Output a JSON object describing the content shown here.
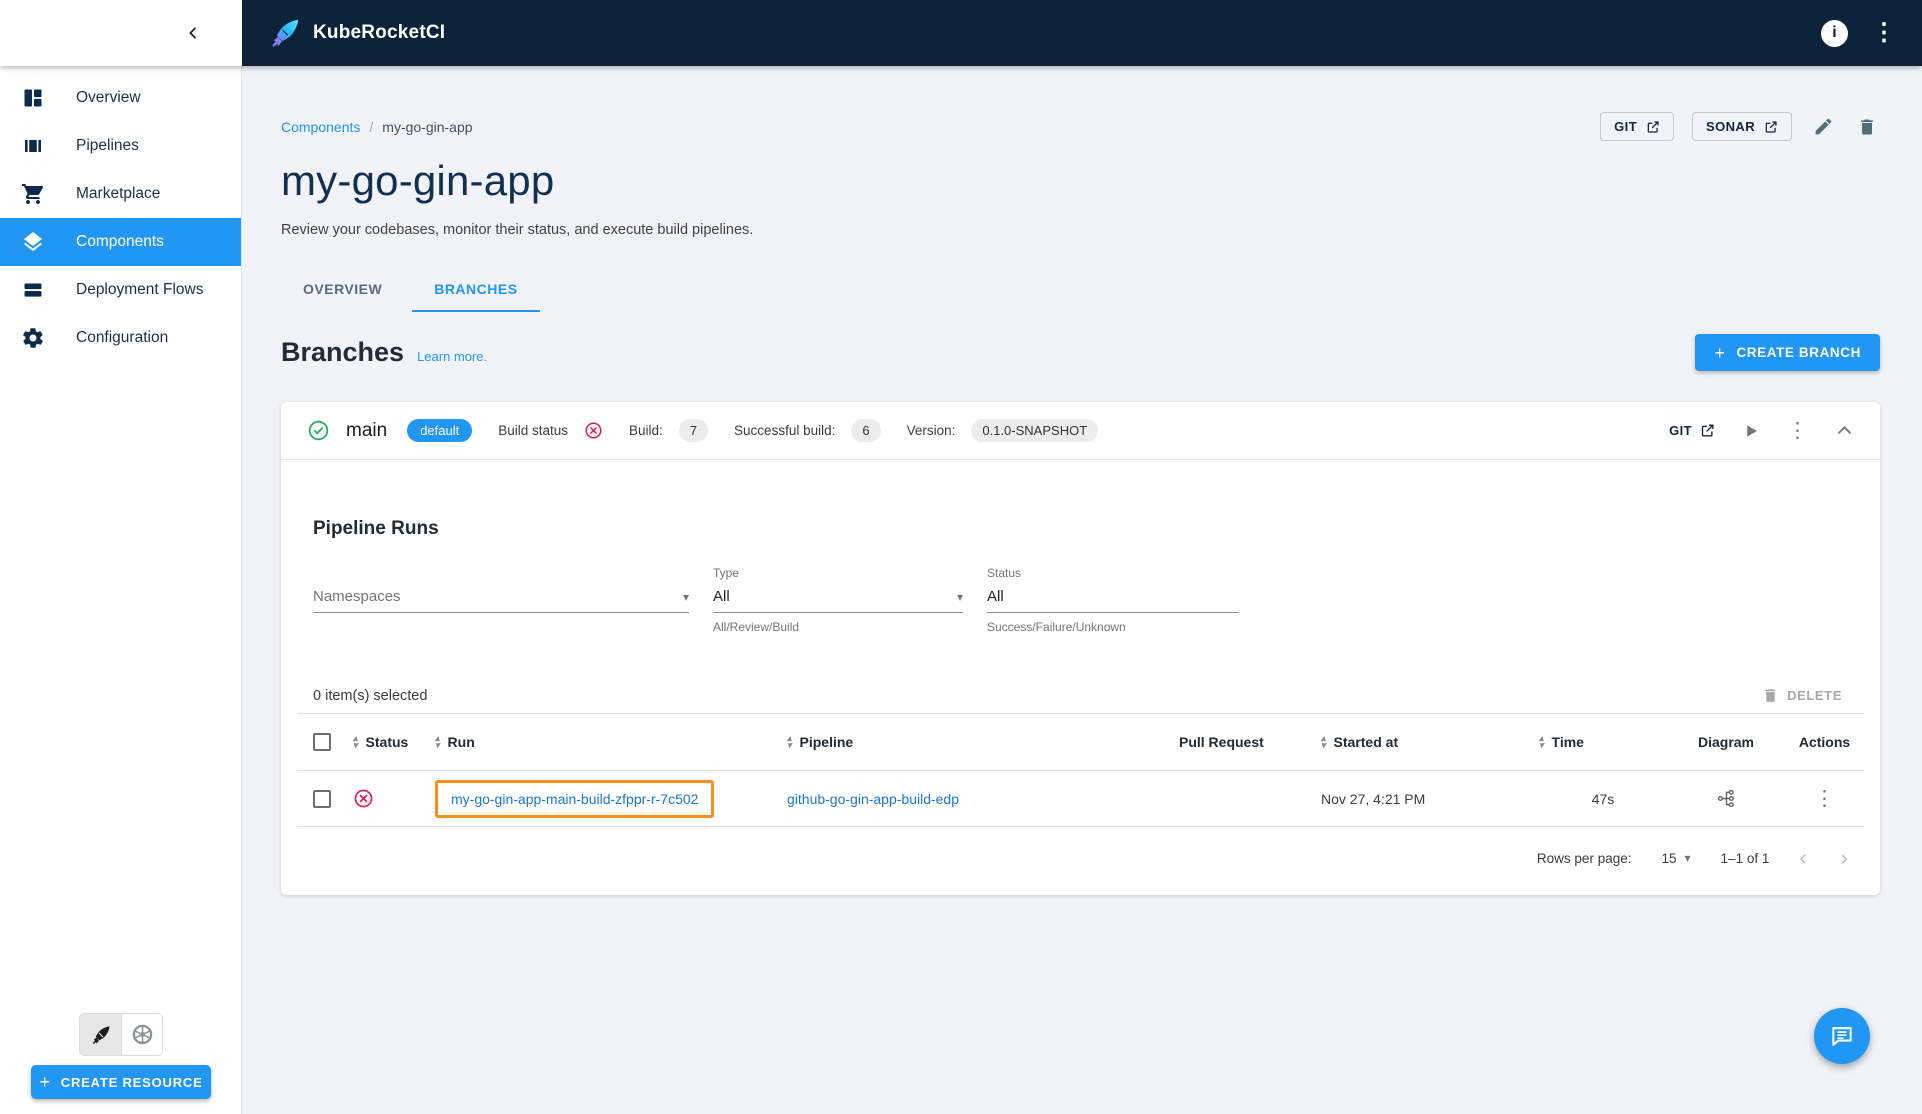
{
  "navbar": {
    "brand": "KubeRocketCI",
    "info_glyph": "i",
    "kebab_glyph": "⋮"
  },
  "sidebar": {
    "items": [
      {
        "label": "Overview"
      },
      {
        "label": "Pipelines"
      },
      {
        "label": "Marketplace"
      },
      {
        "label": "Components"
      },
      {
        "label": "Deployment Flows"
      },
      {
        "label": "Configuration"
      }
    ],
    "active_item": "Components",
    "create_resource_label": "CREATE RESOURCE",
    "plus_glyph": "+"
  },
  "header": {
    "breadcrumb": {
      "parent": "Components",
      "separator": "/",
      "current": "my-go-gin-app"
    },
    "title": "my-go-gin-app",
    "subtitle": "Review your codebases, monitor their status, and execute build pipelines.",
    "git_button_label": "GIT",
    "sonar_button_label": "SONAR"
  },
  "tabs": [
    {
      "label": "OVERVIEW"
    },
    {
      "label": "BRANCHES"
    }
  ],
  "branches_section": {
    "heading": "Branches",
    "learn_more_label": "Learn more.",
    "create_branch_label": "CREATE BRANCH",
    "plus_glyph": "+"
  },
  "branch": {
    "name": "main",
    "badge": "default",
    "build_status_label": "Build status",
    "build_label": "Build:",
    "build_count": "7",
    "successful_build_label": "Successful build:",
    "successful_build_count": "6",
    "version_label": "Version:",
    "version_value": "0.1.0-SNAPSHOT",
    "git_label": "GIT",
    "play_glyph": "▶",
    "kebab_glyph": "⋮",
    "chevron_up_glyph": "⌃"
  },
  "pipeline_runs": {
    "heading": "Pipeline Runs",
    "filters": {
      "namespaces_placeholder": "Namespaces",
      "type_label": "Type",
      "type_value": "All",
      "type_helper": "All/Review/Build",
      "status_label": "Status",
      "status_value": "All",
      "status_helper": "Success/Failure/Unknown",
      "caret_glyph": "▾"
    },
    "selection_text": "0 item(s) selected",
    "delete_label": "DELETE",
    "table": {
      "columns": [
        "Status",
        "Run",
        "Pipeline",
        "Pull Request",
        "Started at",
        "Time",
        "Diagram",
        "Actions"
      ],
      "rows": [
        {
          "status": "failed",
          "run": "my-go-gin-app-main-build-zfppr-r-7c502",
          "pipeline": "github-go-gin-app-build-edp",
          "pull_request": "",
          "started_at": "Nov 27, 4:21 PM",
          "time": "47s",
          "kebab_glyph": "⋮"
        }
      ]
    },
    "pagination": {
      "rows_per_page_label": "Rows per page:",
      "rows_per_page_value": "15",
      "range_text": "1–1 of 1",
      "prev_glyph": "‹",
      "next_glyph": "›",
      "caret_glyph": "▾"
    }
  },
  "colors": {
    "accent": "#2196f3",
    "navbar_bg": "#0c2339",
    "link": "#1976d2",
    "error": "#e2194f",
    "success": "#27ae60",
    "annotation_orange": "#f68f1e",
    "content_bg": "#f1f3f9"
  },
  "icons": {
    "sort_asc_glyph": "▴",
    "sort_desc_glyph": "▾"
  }
}
